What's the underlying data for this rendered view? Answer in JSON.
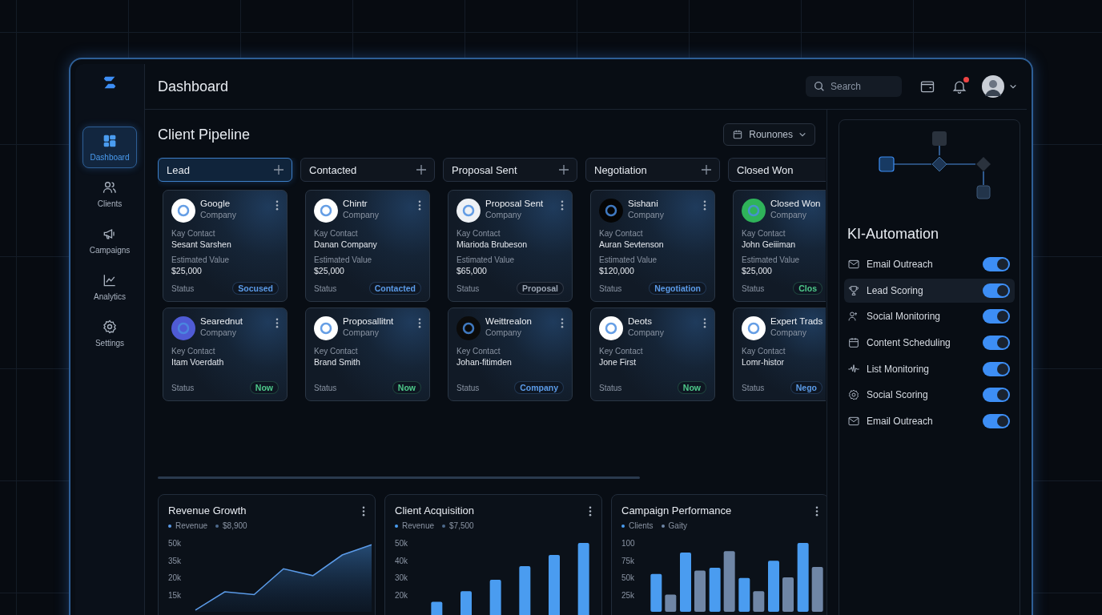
{
  "app": {
    "title": "Dashboard",
    "search": {
      "placeholder": "Search"
    },
    "notifications": true
  },
  "sidebar": {
    "items": [
      {
        "label": "Dashboard",
        "selected": true
      },
      {
        "label": "Clients",
        "selected": false
      },
      {
        "label": "Campaigns",
        "selected": false
      },
      {
        "label": "Analytics",
        "selected": false
      },
      {
        "label": "Settings",
        "selected": false
      }
    ]
  },
  "pipeline": {
    "title": "Client Pipeline",
    "filter": "Rounones",
    "columns": [
      {
        "title": "Lead",
        "selected": true,
        "cards": [
          {
            "name": "Google",
            "type": "Company",
            "color": "#ffffff",
            "contact_label": "Kay Contact",
            "contact": "Sesant Sarshen",
            "value_label": "Estimated Value",
            "value": "$25,000",
            "status_label": "Status",
            "status": {
              "text": "Socused",
              "color": "#5b9be8"
            }
          },
          {
            "name": "Searednut",
            "type": "Company",
            "color": "#4f5bd5",
            "contact_label": "Key Contact",
            "contact": "Itam Voerdath",
            "status_label": "Status",
            "status": {
              "text": "Now",
              "color": "#4ec98a"
            }
          }
        ]
      },
      {
        "title": "Contacted",
        "selected": false,
        "cards": [
          {
            "name": "Chintr",
            "type": "Company",
            "color": "#ffffff",
            "contact_label": "Kay Contact",
            "contact": "Danan Company",
            "value_label": "Estimated Value",
            "value": "$25,000",
            "status_label": "Status",
            "status": {
              "text": "Contacted",
              "color": "#5b9be8"
            }
          },
          {
            "name": "Proposallitnt",
            "type": "Company",
            "color": "#ffffff",
            "contact_label": "Key Contact",
            "contact": "Brand Smith",
            "status_label": "Status",
            "status": {
              "text": "Now",
              "color": "#4ec98a"
            }
          }
        ]
      },
      {
        "title": "Proposal Sent",
        "selected": false,
        "cards": [
          {
            "name": "Proposal Sent",
            "type": "Company",
            "color": "#eef1f5",
            "contact_label": "Kay Contact",
            "contact": "Miarioda Brubeson",
            "value_label": "Estimated Value",
            "value": "$65,000",
            "status_label": "Status",
            "status": {
              "text": "Proposal",
              "color": "#9aa4b2"
            }
          },
          {
            "name": "Weittrealon",
            "type": "Company",
            "color": "#0b0b0b",
            "contact_label": "Key Contact",
            "contact": "Johan-fitimden",
            "status_label": "Status",
            "status": {
              "text": "Company",
              "color": "#5b9be8"
            }
          }
        ]
      },
      {
        "title": "Negotiation",
        "selected": false,
        "cards": [
          {
            "name": "Sishani",
            "type": "Company",
            "color": "#050505",
            "contact_label": "Kay Contact",
            "contact": "Auran Sevtenson",
            "value_label": "Estimated Value",
            "value": "$120,000",
            "status_label": "Status",
            "status": {
              "text": "Negotiation",
              "color": "#5b9be8"
            }
          },
          {
            "name": "Deots",
            "type": "Company",
            "color": "#ffffff",
            "contact_label": "Key Contact",
            "contact": "Jone First",
            "status_label": "Status",
            "status": {
              "text": "Now",
              "color": "#4ec98a"
            }
          }
        ]
      },
      {
        "title": "Closed Won",
        "selected": false,
        "cards": [
          {
            "name": "Closed Won",
            "type": "Company",
            "color": "#2fb35a",
            "contact_label": "Kay Contact",
            "contact": "John Geiiiman",
            "value_label": "Estimated Value",
            "value": "$25,000",
            "status_label": "Status",
            "status": {
              "text": "Clos",
              "color": "#4ec98a"
            }
          },
          {
            "name": "Expert Trads",
            "type": "Company",
            "color": "#ffffff",
            "contact_label": "Kay Contact",
            "contact": "Lomr-histor",
            "status_label": "Status",
            "status": {
              "text": "Nego",
              "color": "#5b9be8"
            }
          }
        ]
      }
    ]
  },
  "charts": [
    {
      "title": "Revenue Growth",
      "kind": "area",
      "legend": [
        {
          "text": "Revenue",
          "color": "#5b9be8"
        },
        {
          "text": "$8,900",
          "color": "#4d6a8c"
        }
      ],
      "y_labels": [
        "50k",
        "35k",
        "20k",
        "15k"
      ]
    },
    {
      "title": "Client Acquisition",
      "note": {
        "text": "$7,500",
        "color": "#4d6a8c"
      },
      "chart_data": {
        "type": "bar",
        "categories": [
          null,
          null,
          null,
          null,
          null,
          null
        ],
        "ylim": [
          0,
          50000
        ],
        "yticks": [
          {
            "value": 50000,
            "label": "50k"
          },
          {
            "value": 40000,
            "label": "40k"
          },
          {
            "value": 30000,
            "label": "30k"
          },
          {
            "value": 20000,
            "label": "20k"
          }
        ],
        "series": [
          {
            "name": "Revenue",
            "color": "#4a9cf0",
            "values": [
              15800,
              22000,
              28600,
              36500,
              43000,
              50000
            ]
          }
        ]
      }
    },
    {
      "title": "Campaign Performance",
      "kind": "grouped-bars",
      "legend": [
        {
          "text": "Clients",
          "color": "#4a9cf0"
        },
        {
          "text": "Gaity",
          "color": "#6f86a6"
        }
      ],
      "y_labels": [
        "100",
        "75k",
        "50k",
        "25k"
      ]
    }
  ],
  "automation": {
    "title": "KI-Automation",
    "items": [
      {
        "label": "Email Outreach",
        "on": true,
        "selected": false
      },
      {
        "label": "Lead Scoring",
        "on": true,
        "selected": true
      },
      {
        "label": "Social Monitoring",
        "on": true,
        "selected": false
      },
      {
        "label": "Content Scheduling",
        "on": true,
        "selected": false
      },
      {
        "label": "List Monitoring",
        "on": true,
        "selected": false
      },
      {
        "label": "Social Scoring",
        "on": true,
        "selected": false
      },
      {
        "label": "Email Outreach",
        "on": true,
        "selected": false
      }
    ]
  }
}
